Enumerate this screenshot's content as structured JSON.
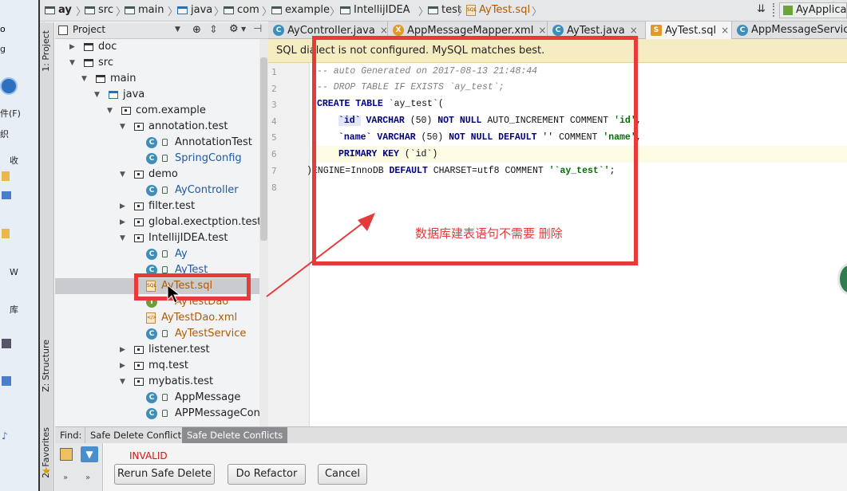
{
  "desktop": {
    "items": [
      "收",
      "库",
      "W",
      "件(F)",
      "织"
    ]
  },
  "breadcrumb": {
    "items": [
      "ay",
      "src",
      "main",
      "java",
      "com",
      "example",
      "IntellijIDEA",
      "test",
      "AyTest.sql"
    ],
    "run_config": "AyApplicat"
  },
  "toolwindows": {
    "project": "1: Project",
    "structure": "Z: Structure",
    "favorites": "2: Favorites"
  },
  "project_panel": {
    "title": "Project",
    "tree": [
      {
        "label": "doc",
        "type": "folder",
        "depth": 0,
        "expanded": false
      },
      {
        "label": "src",
        "type": "folder",
        "depth": 0,
        "expanded": true
      },
      {
        "label": "main",
        "type": "folder",
        "depth": 1,
        "expanded": true
      },
      {
        "label": "java",
        "type": "folder",
        "depth": 2,
        "expanded": true
      },
      {
        "label": "com.example",
        "type": "package",
        "depth": 3,
        "expanded": true
      },
      {
        "label": "annotation.test",
        "type": "package",
        "depth": 4,
        "expanded": true
      },
      {
        "label": "AnnotationTest",
        "type": "class",
        "depth": 5
      },
      {
        "label": "SpringConfig",
        "type": "class",
        "depth": 5
      },
      {
        "label": "demo",
        "type": "package",
        "depth": 4,
        "expanded": true
      },
      {
        "label": "AyController",
        "type": "class",
        "depth": 5
      },
      {
        "label": "filter.test",
        "type": "package",
        "depth": 4,
        "expanded": false
      },
      {
        "label": "global.exectption.test",
        "type": "package",
        "depth": 4,
        "expanded": false
      },
      {
        "label": "IntellijIDEA.test",
        "type": "package",
        "depth": 4,
        "expanded": true
      },
      {
        "label": "Ay",
        "type": "class",
        "depth": 5
      },
      {
        "label": "AyTest",
        "type": "class",
        "depth": 5
      },
      {
        "label": "AyTest.sql",
        "type": "sql",
        "depth": 5,
        "selected": true
      },
      {
        "label": "AyTestDao",
        "type": "iface",
        "depth": 5
      },
      {
        "label": "AyTestDao.xml",
        "type": "xml",
        "depth": 5
      },
      {
        "label": "AyTestService",
        "type": "class",
        "depth": 5
      },
      {
        "label": "listener.test",
        "type": "package",
        "depth": 4,
        "expanded": false
      },
      {
        "label": "mq.test",
        "type": "package",
        "depth": 4,
        "expanded": false
      },
      {
        "label": "mybatis.test",
        "type": "package",
        "depth": 4,
        "expanded": true
      },
      {
        "label": "AppMessage",
        "type": "class",
        "depth": 5
      },
      {
        "label": "APPMessageContro",
        "type": "class",
        "depth": 5
      }
    ]
  },
  "editor": {
    "tabs": [
      {
        "label": "AyController.java",
        "icon": "C",
        "active": false
      },
      {
        "label": "AppMessageMapper.xml",
        "icon": "X",
        "active": false
      },
      {
        "label": "AyTest.java",
        "icon": "C",
        "active": false
      },
      {
        "label": "AyTest.sql",
        "icon": "S",
        "active": true
      },
      {
        "label": "AppMessageServic",
        "icon": "C",
        "active": false
      }
    ],
    "notice": "SQL dialect is not configured. MySQL matches best.",
    "line_numbers": [
      "1",
      "2",
      "3",
      "4",
      "5",
      "6",
      "7",
      "8"
    ],
    "code": {
      "l1": "-- auto Generated on 2017-08-13 21:48:44",
      "l2": "-- DROP TABLE IF EXISTS `ay_test`;",
      "l3_kw": "CREATE TABLE",
      "l3_rest": " `ay_test`(",
      "l4_id": "`id`",
      "l4_type": " VARCHAR",
      "l4_size": " (50) ",
      "l4_kw": "NOT NULL",
      "l4_rest": " AUTO_INCREMENT COMMENT ",
      "l4_str": "'id'",
      "l4_end": ",",
      "l5_name": "`name`",
      "l5_type": " VARCHAR",
      "l5_size": " (50) ",
      "l5_kw": "NOT NULL DEFAULT",
      "l5_rest": " '' COMMENT ",
      "l5_str": "'name'",
      "l5_end": ",",
      "l6_kw": "PRIMARY KEY",
      "l6_rest": " (`id`)",
      "l7_a": ")ENGINE=InnoDB ",
      "l7_kw": "DEFAULT",
      "l7_b": " CHARSET=utf8 COMMENT ",
      "l7_str": "'`ay_test`'",
      "l7_end": ";"
    },
    "annotation": "数据库建表语句不需要    删除"
  },
  "find_panel": {
    "label": "Find:",
    "tabs": [
      "Safe Delete Conflicts",
      "Safe Delete Conflicts"
    ],
    "status": "INVALID",
    "buttons": {
      "rerun": "Rerun Safe Delete",
      "refactor": "Do Refactor",
      "cancel": "Cancel"
    }
  },
  "colors": {
    "annotation_red": "#e53b3b",
    "keyword_blue": "#000080",
    "notice_bg": "#f6ecc2"
  }
}
